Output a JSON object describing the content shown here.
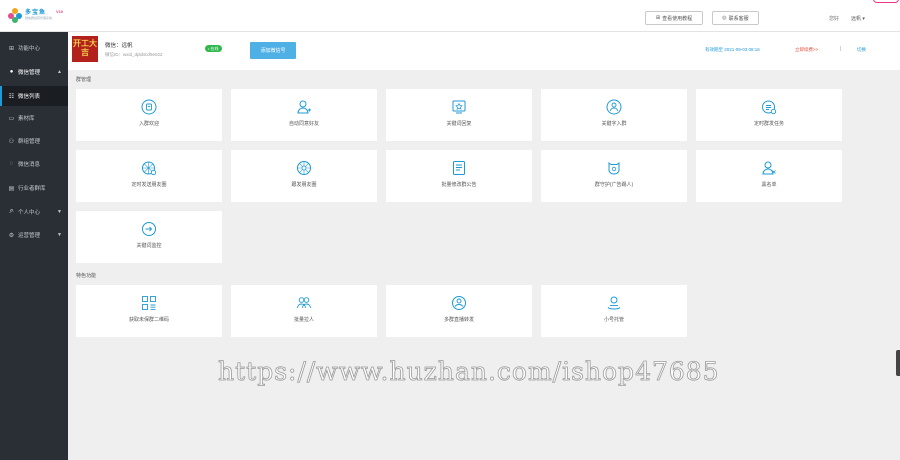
{
  "logo": {
    "title": "多宝鱼",
    "subtitle": "微信群运营管理系统",
    "version": "V10"
  },
  "topbar": {
    "tutorial_label": "查看使用教程",
    "support_label": "联系客服",
    "greeting": "您好",
    "user": "远帆"
  },
  "sidebar": {
    "items": [
      {
        "label": "功能中心",
        "icon": "grid-icon"
      },
      {
        "label": "微信管理",
        "icon": "wechat-icon"
      },
      {
        "label": "微信列表",
        "icon": "list-icon"
      },
      {
        "label": "素材库",
        "icon": "folder-icon"
      },
      {
        "label": "群组管理",
        "icon": "group-icon"
      },
      {
        "label": "微信消息",
        "icon": "message-icon"
      },
      {
        "label": "行业者群库",
        "icon": "database-icon"
      },
      {
        "label": "个人中心",
        "icon": "user-icon"
      },
      {
        "label": "运营管理",
        "icon": "gear-icon"
      }
    ]
  },
  "account": {
    "avatar_text": "开工大吉",
    "name": "微信：远帆",
    "wxid": "微信ID：wxid_dpldstxf9e022",
    "status": "• 在线",
    "add_button": "添加微信号",
    "expire": "有效期至 2021-09-03 08:16",
    "renew": "立即续费>>",
    "separator": "|",
    "switch": "切换"
  },
  "sections": [
    {
      "title": "群管理",
      "cards": [
        {
          "label": "入群欢迎",
          "icon": "welcome-icon"
        },
        {
          "label": "自动同意好友",
          "icon": "add-friend-icon"
        },
        {
          "label": "关键词回复",
          "icon": "keyword-reply-icon"
        },
        {
          "label": "关键字入群",
          "icon": "keyword-join-icon"
        },
        {
          "label": "定时群发任务",
          "icon": "scheduled-task-icon"
        },
        {
          "label": "定时发送朋友圈",
          "icon": "moments-schedule-icon"
        },
        {
          "label": "跟发朋友圈",
          "icon": "moments-follow-icon"
        },
        {
          "label": "批量修改群公告",
          "icon": "notice-icon"
        },
        {
          "label": "群守护(广告踢人)",
          "icon": "guard-icon"
        },
        {
          "label": "黑名单",
          "icon": "blacklist-icon"
        },
        {
          "label": "关键词监控",
          "icon": "monitor-icon"
        }
      ]
    },
    {
      "title": "特色功能",
      "cards": [
        {
          "label": "获取未保群二维码",
          "icon": "qrcode-icon"
        },
        {
          "label": "批量拉人",
          "icon": "bulk-invite-icon"
        },
        {
          "label": "多群直播转发",
          "icon": "live-forward-icon"
        },
        {
          "label": "小号托管",
          "icon": "hosting-icon"
        }
      ]
    }
  ],
  "watermark": "https://www.huzhan.com/ishop47685",
  "colors": {
    "accent": "#1e9ad6",
    "sidebar": "#2a2f36",
    "online": "#2fb84d",
    "warning": "#e74c3c"
  }
}
